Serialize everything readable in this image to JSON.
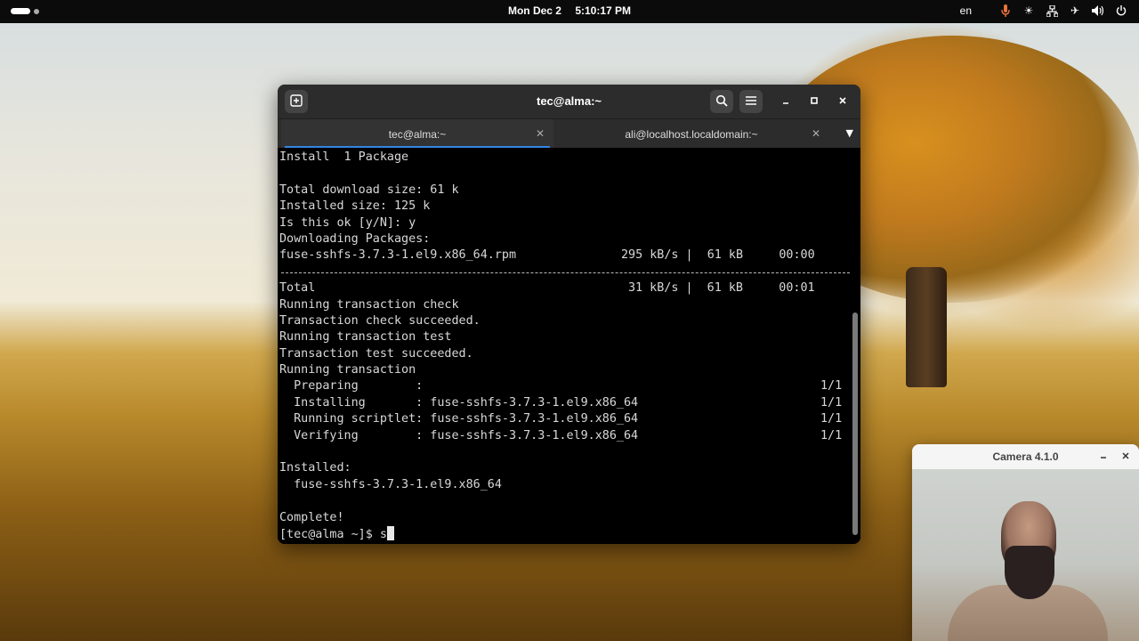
{
  "topbar": {
    "date": "Mon Dec 2",
    "time": "5:10:17 PM",
    "language": "en",
    "tray_icons": [
      "microphone-icon",
      "brightness-icon",
      "network-icon",
      "airplane-icon",
      "volume-icon",
      "power-icon"
    ]
  },
  "terminal": {
    "title": "tec@alma:~",
    "tabs": [
      {
        "label": "tec@alma:~",
        "active": true
      },
      {
        "label": "ali@localhost.localdomain:~",
        "active": false
      }
    ],
    "lines": {
      "l1": "Install  1 Package",
      "l2": "",
      "l3": "Total download size: 61 k",
      "l4": "Installed size: 125 k",
      "l5": "Is this ok [y/N]: y",
      "l6": "Downloading Packages:",
      "l7_name": "fuse-sshfs-3.7.3-1.el9.x86_64.rpm",
      "l7_stats": "295 kB/s |  61 kB     00:00",
      "l9_name": "Total",
      "l9_stats": "31 kB/s |  61 kB     00:01",
      "l10": "Running transaction check",
      "l11": "Transaction check succeeded.",
      "l12": "Running transaction test",
      "l13": "Transaction test succeeded.",
      "l14": "Running transaction",
      "l15": "  Preparing        :",
      "l15_count": "1/1",
      "l16": "  Installing       : fuse-sshfs-3.7.3-1.el9.x86_64",
      "l16_count": "1/1",
      "l17": "  Running scriptlet: fuse-sshfs-3.7.3-1.el9.x86_64",
      "l17_count": "1/1",
      "l18": "  Verifying        : fuse-sshfs-3.7.3-1.el9.x86_64",
      "l18_count": "1/1",
      "l20": "Installed:",
      "l21": "  fuse-sshfs-3.7.3-1.el9.x86_64",
      "l23": "Complete!",
      "prompt": "[tec@alma ~]$ ",
      "input": "s"
    }
  },
  "camera": {
    "title": "Camera 4.1.0"
  }
}
